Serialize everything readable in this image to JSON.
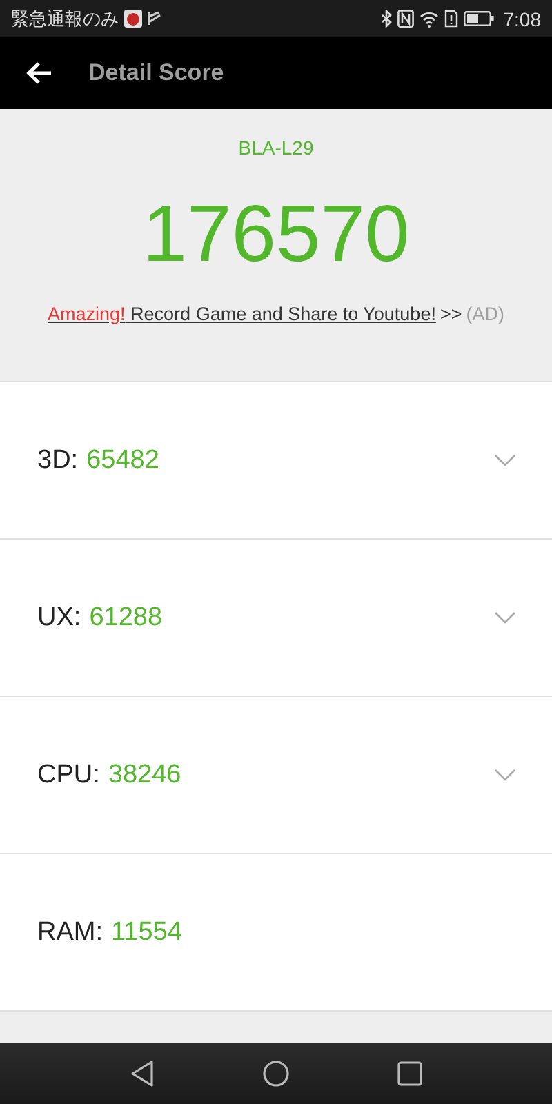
{
  "status_bar": {
    "carrier": "緊急通報のみ",
    "time": "7:08"
  },
  "app_bar": {
    "title": "Detail Score"
  },
  "summary": {
    "device": "BLA-L29",
    "score": "176570",
    "promo": {
      "highlight": "Amazing!",
      "link": "Record Game and Share to Youtube!",
      "arrows": ">>",
      "ad": "(AD)"
    }
  },
  "scores": [
    {
      "label": "3D:",
      "value": "65482",
      "expandable": true
    },
    {
      "label": "UX:",
      "value": "61288",
      "expandable": true
    },
    {
      "label": "CPU:",
      "value": "38246",
      "expandable": true
    },
    {
      "label": "RAM:",
      "value": "11554",
      "expandable": false
    }
  ]
}
